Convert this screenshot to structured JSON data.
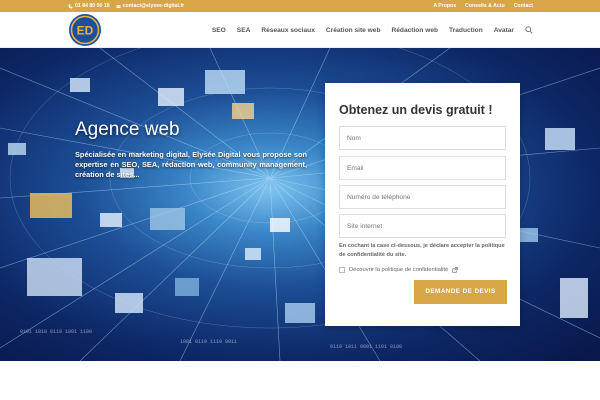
{
  "topbar": {
    "phone": "01 84 80 50 15",
    "email": "contact@elysee-digital.fr",
    "links": [
      "A Propos",
      "Conseils & Actu",
      "Contact"
    ]
  },
  "header": {
    "logo_text": "ED",
    "nav": [
      "SEO",
      "SEA",
      "Réseaux sociaux",
      "Création site web",
      "Rédaction web",
      "Traduction",
      "Avatar"
    ]
  },
  "hero": {
    "title": "Agence web",
    "text": "Spécialisée en marketing digital, Elysée Digital vous propose son expertise en SEO, SEA, rédaction web, community management, création de sites..."
  },
  "form": {
    "title": "Obtenez un devis gratuit !",
    "name_placeholder": "Nom",
    "email_placeholder": "Email",
    "phone_placeholder": "Numéro de téléphone",
    "site_placeholder": "Site internet",
    "consent_text": "En cochant la case ci-dessous, je déclare accepter la politique de confidentialité du site.",
    "checkbox_label": "Découvrir la politique de confidentialité",
    "submit_label": "DEMANDE DE DEVIS"
  },
  "colors": {
    "accent": "#d8a547",
    "logo_blue": "#1d4fa0",
    "logo_gold": "#e9b23a"
  }
}
